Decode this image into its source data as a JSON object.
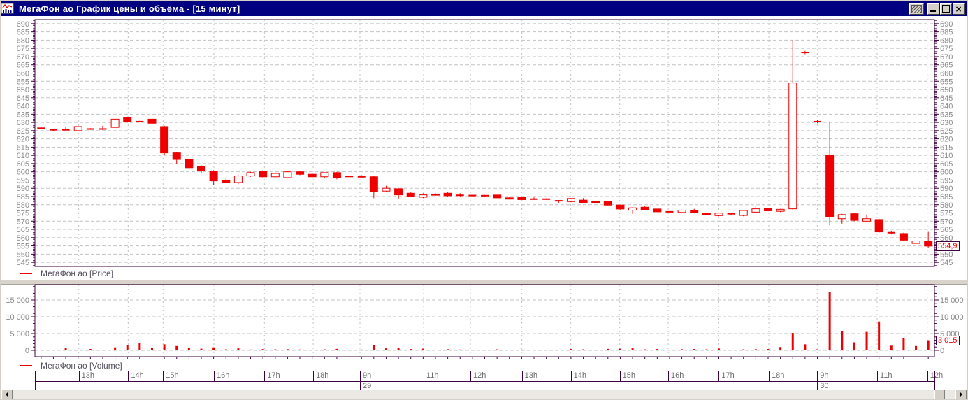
{
  "window": {
    "title": "МегаФон ао График цены и объёма - [15 минут]",
    "icon": "chart-window-icon",
    "controls": {
      "properties": "hatch-pattern-button",
      "minimize": "minimize",
      "maximize": "maximize",
      "close": "close"
    }
  },
  "colors": {
    "titlebar": "#000080",
    "series_red": "#ee0000",
    "frame_purple": "#3f0040",
    "grid": "#c2c2c2",
    "axis_text": "#8a8a8a",
    "chrome": "#d4d0c8"
  },
  "price_panel": {
    "legend": "МегаФон ао [Price]",
    "last_price_label": "554,9",
    "tick_min": 545,
    "tick_max": 690,
    "tick_step": 5
  },
  "volume_panel": {
    "legend": "МегаФон ао [Volume]",
    "last_volume_label": "3 015",
    "ticks": [
      {
        "v": 0,
        "label": "0"
      },
      {
        "v": 5000,
        "label": "5 000"
      },
      {
        "v": 10000,
        "label": "10 000"
      },
      {
        "v": 15000,
        "label": "15 000"
      }
    ]
  },
  "time_axis": {
    "hour_cells": [
      {
        "label": "",
        "f0": 0.0,
        "f1": 0.0487
      },
      {
        "label": "13h",
        "f0": 0.0487,
        "f1": 0.1036
      },
      {
        "label": "14h",
        "f0": 0.1036,
        "f1": 0.1424
      },
      {
        "label": "15h",
        "f0": 0.1424,
        "f1": 0.1989
      },
      {
        "label": "16h",
        "f0": 0.1989,
        "f1": 0.2551
      },
      {
        "label": "17h",
        "f0": 0.2551,
        "f1": 0.3093
      },
      {
        "label": "18h",
        "f0": 0.3093,
        "f1": 0.3613
      },
      {
        "label": "9h",
        "f0": 0.3613,
        "f1": 0.432
      },
      {
        "label": "11h",
        "f0": 0.432,
        "f1": 0.4841
      },
      {
        "label": "12h",
        "f0": 0.4841,
        "f1": 0.5413
      },
      {
        "label": "13h",
        "f0": 0.5413,
        "f1": 0.5957
      },
      {
        "label": "14h",
        "f0": 0.5957,
        "f1": 0.6501
      },
      {
        "label": "15h",
        "f0": 0.6501,
        "f1": 0.704
      },
      {
        "label": "16h",
        "f0": 0.704,
        "f1": 0.7602
      },
      {
        "label": "17h",
        "f0": 0.7602,
        "f1": 0.8159
      },
      {
        "label": "18h",
        "f0": 0.8159,
        "f1": 0.8697
      },
      {
        "label": "9h",
        "f0": 0.8697,
        "f1": 0.9363
      },
      {
        "label": "11h",
        "f0": 0.9363,
        "f1": 0.992
      },
      {
        "label": "12h",
        "f0": 0.992,
        "f1": 1.0
      }
    ],
    "date_cells": [
      {
        "label": "",
        "f0": 0.0,
        "f1": 0.3613
      },
      {
        "label": "29",
        "f0": 0.3613,
        "f1": 0.8697
      },
      {
        "label": "30",
        "f0": 0.8697,
        "f1": 1.0
      }
    ]
  },
  "scrollbar": {
    "left_arrow": "scroll-left",
    "right_arrow": "scroll-right",
    "thumb_f0": 0.978,
    "thumb_f1": 0.989
  },
  "chart_data": {
    "type": "candlestick",
    "symbol": "МегаФон ао",
    "interval": "15 минут",
    "price_ylim": [
      542.5,
      692.5
    ],
    "volume_ylim": [
      0,
      20000
    ],
    "last_price": 554.9,
    "last_volume": 3015,
    "legend_position": "bottom-left",
    "grid": true,
    "candles_format": [
      "open",
      "high",
      "low",
      "close",
      "volume"
    ],
    "candles": [
      [
        626.5,
        627.5,
        626.0,
        626.5,
        150
      ],
      [
        625.5,
        626.0,
        625.0,
        625.5,
        100
      ],
      [
        625.5,
        627.5,
        625.0,
        625.5,
        700
      ],
      [
        625.0,
        627.5,
        624.5,
        627.5,
        200
      ],
      [
        626.0,
        626.5,
        625.5,
        626.0,
        400
      ],
      [
        626.0,
        628.0,
        625.5,
        626.0,
        150
      ],
      [
        627.0,
        632.0,
        626.5,
        632.0,
        900
      ],
      [
        633.0,
        633.5,
        630.0,
        630.5,
        1500
      ],
      [
        630.5,
        631.0,
        630.0,
        630.5,
        2100
      ],
      [
        632.0,
        632.5,
        629.0,
        629.5,
        800
      ],
      [
        627.5,
        628.0,
        610.0,
        611.5,
        1800
      ],
      [
        611.5,
        612.0,
        604.5,
        607.5,
        1300
      ],
      [
        607.5,
        608.0,
        602.0,
        602.5,
        700
      ],
      [
        603.5,
        604.0,
        599.0,
        600.5,
        500
      ],
      [
        600.5,
        601.0,
        592.0,
        594.5,
        900
      ],
      [
        595.0,
        596.5,
        593.0,
        593.5,
        300
      ],
      [
        593.5,
        598.0,
        592.5,
        597.5,
        600
      ],
      [
        597.5,
        600.0,
        597.0,
        599.5,
        250
      ],
      [
        600.5,
        601.0,
        596.5,
        597.0,
        400
      ],
      [
        597.0,
        599.5,
        596.5,
        599.0,
        300
      ],
      [
        596.5,
        600.0,
        596.0,
        600.0,
        350
      ],
      [
        600.0,
        600.5,
        598.0,
        598.5,
        250
      ],
      [
        598.5,
        599.0,
        596.5,
        597.0,
        200
      ],
      [
        597.0,
        599.5,
        596.5,
        599.5,
        300
      ],
      [
        599.5,
        600.0,
        595.5,
        596.5,
        450
      ],
      [
        597.2,
        597.7,
        596.7,
        597.2,
        200
      ],
      [
        597.0,
        598.0,
        596.5,
        597.0,
        250
      ],
      [
        597.0,
        597.5,
        584.0,
        588.0,
        1600
      ],
      [
        588.3,
        591.5,
        588.0,
        590.0,
        600
      ],
      [
        589.7,
        590.0,
        583.5,
        586.0,
        800
      ],
      [
        587.0,
        587.5,
        585.0,
        585.2,
        400
      ],
      [
        584.6,
        587.0,
        584.0,
        586.0,
        500
      ],
      [
        586.5,
        587.0,
        585.5,
        585.8,
        200
      ],
      [
        587.0,
        587.5,
        585.0,
        585.5,
        350
      ],
      [
        586.0,
        587.0,
        585.0,
        585.5,
        250
      ],
      [
        585.6,
        586.0,
        585.2,
        585.6,
        150
      ],
      [
        585.5,
        586.0,
        585.0,
        585.5,
        100
      ],
      [
        585.9,
        586.0,
        584.0,
        584.2,
        300
      ],
      [
        584.2,
        584.5,
        583.2,
        583.4,
        150
      ],
      [
        584.5,
        585.0,
        583.0,
        583.1,
        250
      ],
      [
        583.4,
        584.5,
        583.0,
        583.4,
        150
      ],
      [
        583.4,
        583.8,
        583.0,
        583.4,
        100
      ],
      [
        582.4,
        582.8,
        581.0,
        582.4,
        150
      ],
      [
        581.9,
        584.0,
        581.5,
        583.8,
        400
      ],
      [
        582.8,
        584.0,
        580.8,
        581.0,
        300
      ],
      [
        582.0,
        582.3,
        581.0,
        581.3,
        200
      ],
      [
        581.9,
        582.0,
        579.5,
        579.8,
        450
      ],
      [
        579.8,
        580.0,
        577.0,
        577.4,
        500
      ],
      [
        576.7,
        578.5,
        574.5,
        578.1,
        600
      ],
      [
        578.5,
        579.0,
        577.0,
        577.1,
        300
      ],
      [
        577.4,
        577.5,
        575.5,
        575.7,
        400
      ],
      [
        575.7,
        576.0,
        575.3,
        575.7,
        150
      ],
      [
        575.3,
        577.0,
        575.0,
        576.7,
        350
      ],
      [
        576.3,
        577.5,
        574.8,
        575.3,
        400
      ],
      [
        574.9,
        575.0,
        573.5,
        573.9,
        300
      ],
      [
        573.4,
        575.0,
        573.0,
        574.9,
        550
      ],
      [
        574.5,
        575.0,
        574.0,
        574.5,
        200
      ],
      [
        573.5,
        576.5,
        573.0,
        576.5,
        300
      ],
      [
        575.5,
        579.0,
        575.0,
        577.5,
        350
      ],
      [
        577.8,
        578.0,
        576.0,
        576.3,
        400
      ],
      [
        576.0,
        577.5,
        575.5,
        577.2,
        1000
      ],
      [
        577.5,
        680.0,
        576.5,
        654.0,
        5200
      ],
      [
        672.5,
        673.5,
        671.5,
        672.5,
        1800
      ],
      [
        630.5,
        631.5,
        629.5,
        630.5,
        300
      ],
      [
        610.0,
        630.5,
        567.5,
        572.5,
        17300
      ],
      [
        571.5,
        574.5,
        568.5,
        574.0,
        5700
      ],
      [
        574.5,
        575.0,
        570.0,
        570.5,
        2400
      ],
      [
        570.0,
        574.0,
        569.5,
        571.5,
        5500
      ],
      [
        571.0,
        571.5,
        563.0,
        563.5,
        8600
      ],
      [
        563.0,
        564.0,
        562.0,
        563.0,
        1400
      ],
      [
        562.5,
        563.0,
        558.0,
        558.5,
        3700
      ],
      [
        556.5,
        558.5,
        556.0,
        558.0,
        1300
      ],
      [
        558.0,
        563.5,
        554.0,
        554.9,
        3015
      ]
    ]
  }
}
